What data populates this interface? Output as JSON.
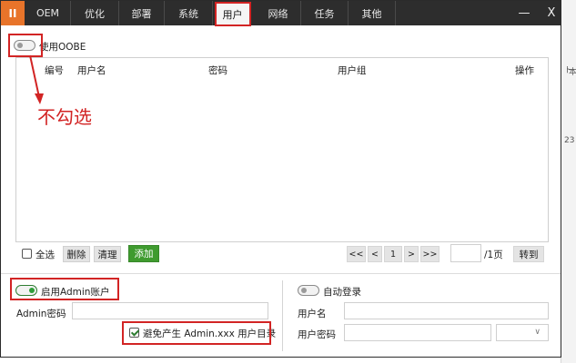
{
  "logo": "II",
  "tabs": [
    {
      "label": "OEM"
    },
    {
      "label": "优化"
    },
    {
      "label": "部署"
    },
    {
      "label": "系统"
    },
    {
      "label": "用户"
    },
    {
      "label": "网络"
    },
    {
      "label": "任务"
    },
    {
      "label": "其他"
    }
  ],
  "active_tab": "用户",
  "window_controls": {
    "minimize": "—",
    "close": "X"
  },
  "oobe": {
    "label": "使用OOBE",
    "enabled": false
  },
  "table": {
    "columns": [
      "编号",
      "用户名",
      "密码",
      "用户组",
      "操作"
    ],
    "rows": []
  },
  "toolbar": {
    "select_all": "全选",
    "delete": "删除",
    "clear": "清理",
    "add": "添加"
  },
  "pagination": {
    "first": "<<",
    "prev": "<",
    "current": "1",
    "next": ">",
    "last": ">>",
    "page_input": "",
    "total": "/1页",
    "go": "转到"
  },
  "admin": {
    "toggle_label": "启用Admin账户",
    "enabled": true,
    "password_label": "Admin密码",
    "password_value": "",
    "avoid_label": "避免产生 Admin.xxx 用户目录",
    "avoid_checked": true
  },
  "autologin": {
    "toggle_label": "自动登录",
    "enabled": false,
    "username_label": "用户名",
    "username_value": "",
    "password_label": "用户密码",
    "password_value": "",
    "select_value": ""
  },
  "annotation": {
    "text": "不勾选",
    "color": "#d22424"
  },
  "background_strip": {
    "chars": [
      "ト",
      "本",
      "23"
    ]
  }
}
